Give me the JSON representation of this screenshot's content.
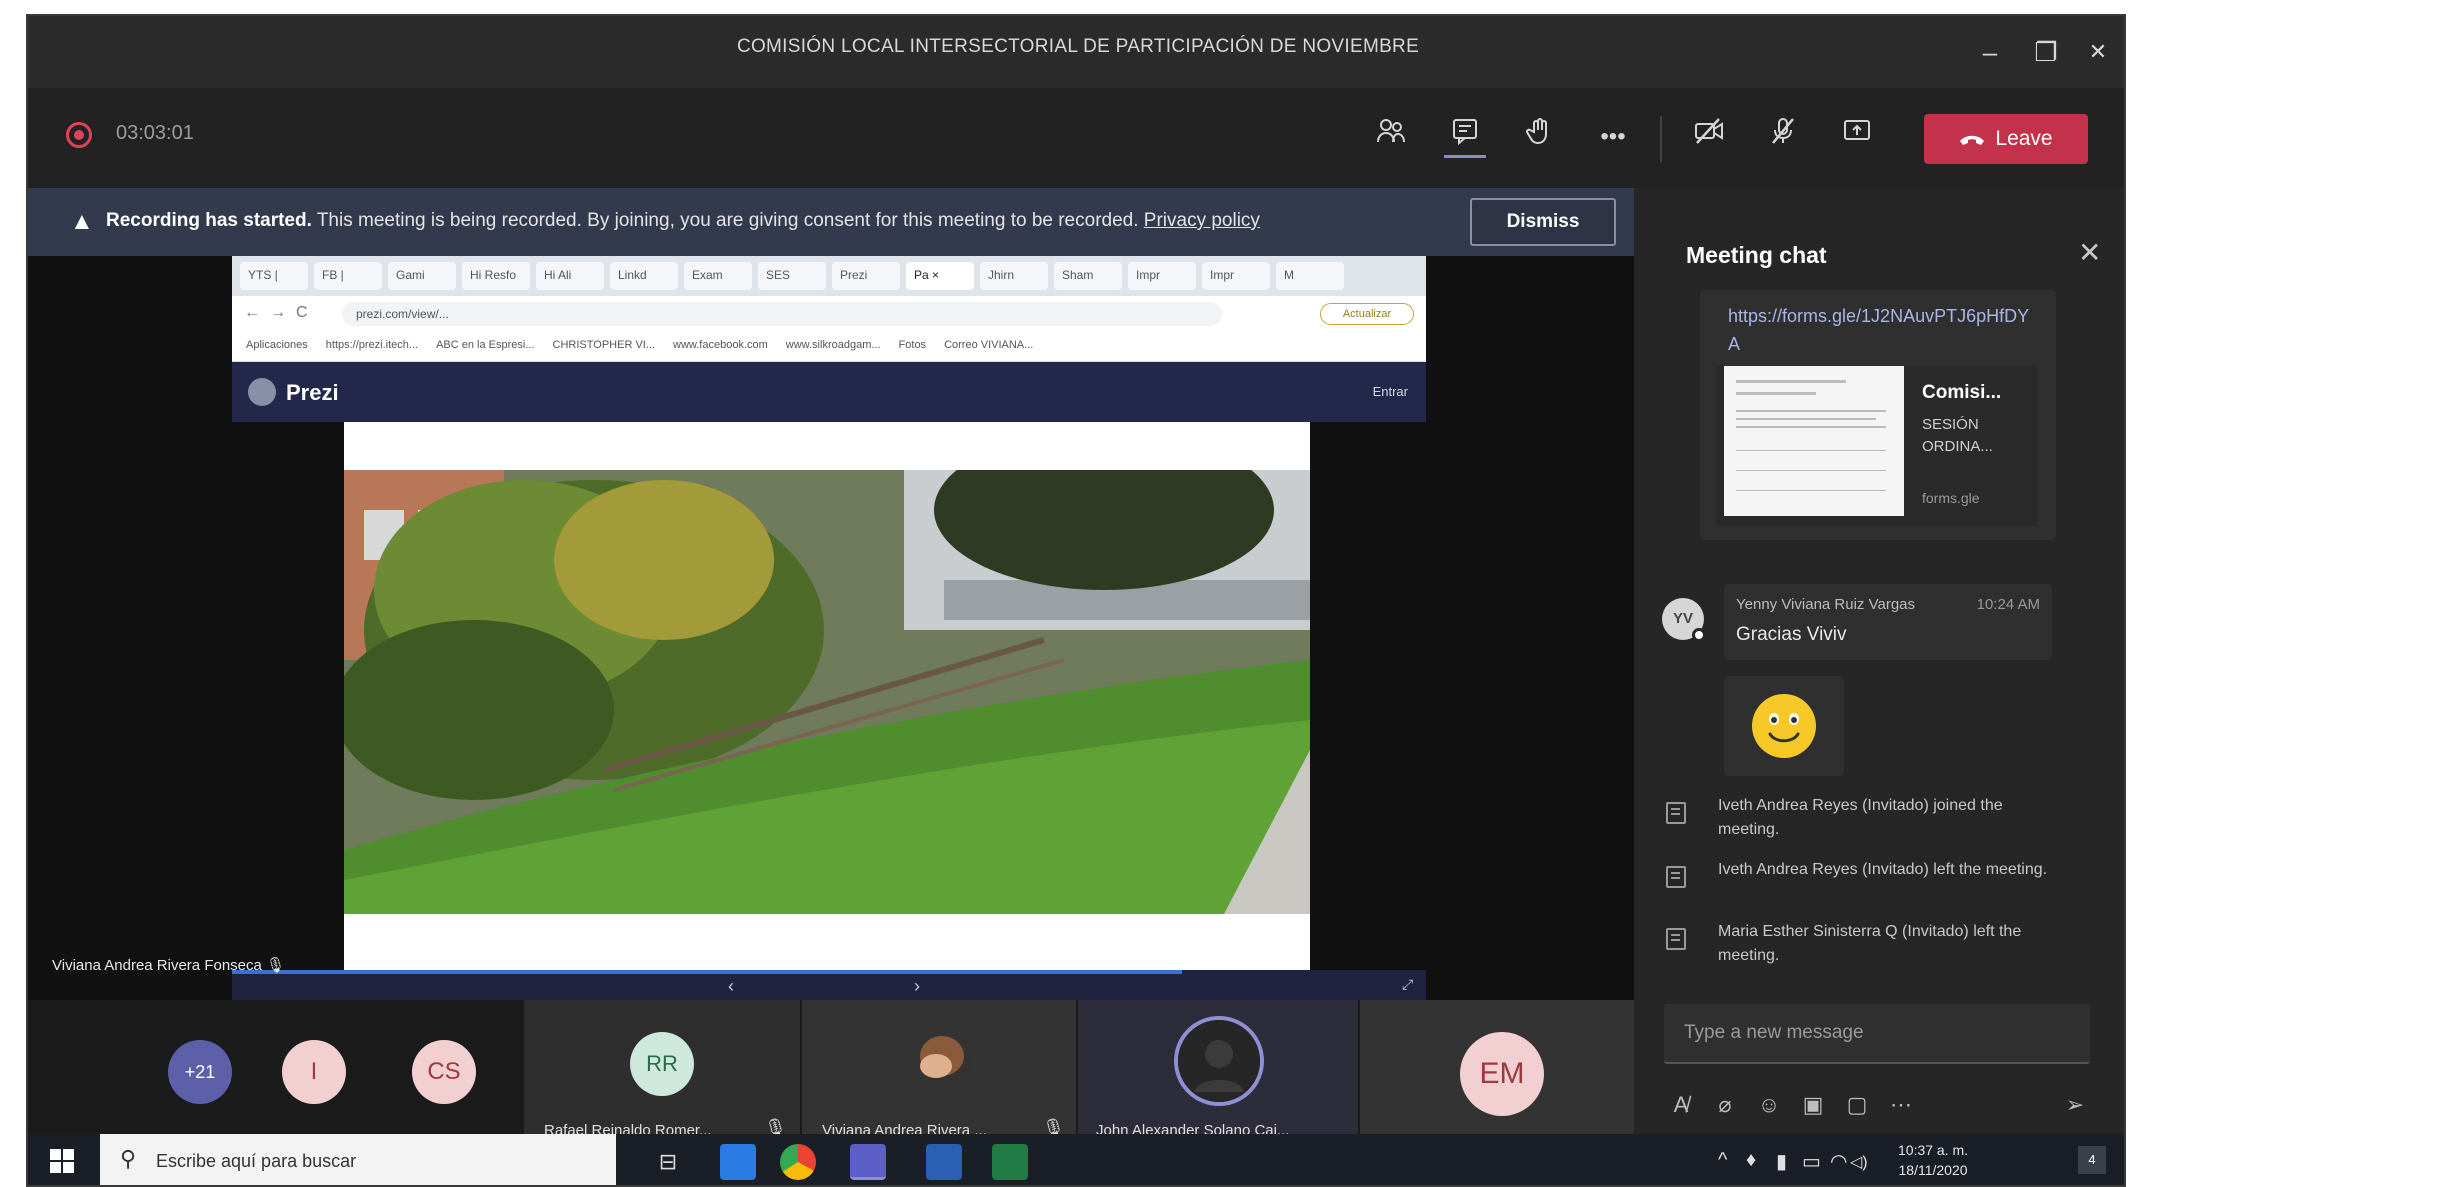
{
  "window": {
    "title": "COMISIÓN LOCAL INTERSECTORIAL DE PARTICIPACIÓN DE NOVIEMBRE",
    "minimize": "–",
    "maximize": "❐",
    "close": "✕"
  },
  "toolbar": {
    "timer": "03:03:01",
    "leave_label": "Leave"
  },
  "banner": {
    "bold": "Recording has started.",
    "text": " This meeting is being recorded. By joining, you are giving consent for this meeting to be recorded. ",
    "link": "Privacy policy",
    "dismiss": "Dismiss"
  },
  "browser": {
    "tabs": [
      "YTS |",
      "FB |",
      "Gami",
      "Hi Resfo",
      "Hi Ali",
      "Linkd",
      "Exam",
      "SES",
      "Prezi",
      "Pa ×",
      "Jhirn",
      "Sham",
      "Impr",
      "Impr",
      "M"
    ],
    "url": "prezi.com/view/...",
    "update": "Actualizar",
    "bookmarks": [
      "Aplicaciones",
      "https://prezi.itech...",
      "ABC en la Espresi...",
      "CHRISTOPHER VI...",
      "www.facebook.com",
      "www.silkroadgam...",
      "Fotos",
      "Correo VIVIANA..."
    ],
    "prezi_name": "Prezi",
    "prezi_enter": "Entrar"
  },
  "stage": {
    "speaker_name": "Viviana Andrea Rivera Fonseca"
  },
  "chat": {
    "title": "Meeting chat",
    "link_url": "https://forms.gle/1J2NAuvPTJ6pHfDYA",
    "preview_title": "Comisi...",
    "preview_desc": "SESIÓN ORDINA...",
    "preview_site": "forms.gle",
    "msg_initials": "YV",
    "msg_author": "Yenny Viviana Ruiz Vargas",
    "msg_time": "10:24 AM",
    "msg_text": "Gracias Viviv",
    "system": [
      "Iveth Andrea Reyes (Invitado) joined the meeting.",
      "Iveth Andrea Reyes (Invitado) left the meeting.",
      "Maria Esther Sinisterra Q (Invitado) left the meeting."
    ],
    "compose_placeholder": "Type a new message"
  },
  "participants": {
    "overflow": "+21",
    "a1": "I",
    "a2": "CS",
    "rr": "RR",
    "rr_name": "Rafael Reinaldo Romer...",
    "vi_name": "Viviana Andrea Rivera ...",
    "js_name": "John Alexander Solano Cai...",
    "em": "EM"
  },
  "taskbar": {
    "search_placeholder": "Escribe aquí para buscar",
    "time": "10:37 a. m.",
    "date": "18/11/2020",
    "notif": "4"
  },
  "colors": {
    "accent": "#6264a7",
    "leave": "#c4314b",
    "banner": "#333a4e",
    "record": "#e0425b"
  }
}
